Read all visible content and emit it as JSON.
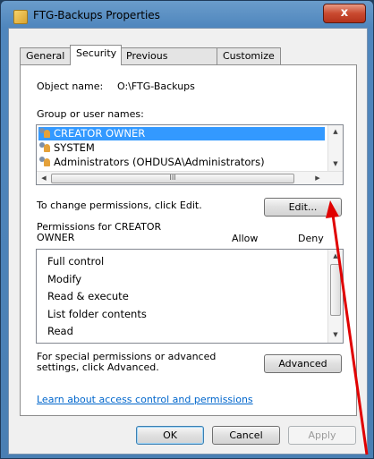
{
  "window": {
    "title": "FTG-Backups Properties",
    "close_glyph": "x"
  },
  "tabs": [
    {
      "label": "General",
      "active": false
    },
    {
      "label": "Security",
      "active": true
    },
    {
      "label": "Previous Versions",
      "active": false
    },
    {
      "label": "Customize",
      "active": false
    }
  ],
  "security": {
    "object_name_label": "Object name:",
    "object_name_value": "O:\\FTG-Backups",
    "group_label": "Group or user names:",
    "users": [
      {
        "name": "CREATOR OWNER",
        "selected": true
      },
      {
        "name": "SYSTEM",
        "selected": false
      },
      {
        "name": "Administrators (OHDUSA\\Administrators)",
        "selected": false
      }
    ],
    "hscroll_grip": "III",
    "change_text": "To change permissions, click Edit.",
    "edit_label": "Edit...",
    "permissions_for": "Permissions for CREATOR OWNER",
    "allow_header": "Allow",
    "deny_header": "Deny",
    "permissions": [
      "Full control",
      "Modify",
      "Read & execute",
      "List folder contents",
      "Read"
    ],
    "special_text": "For special permissions or advanced settings, click Advanced.",
    "advanced_label": "Advanced",
    "learn_link": "Learn about access control and permissions"
  },
  "footer": {
    "ok_label": "OK",
    "cancel_label": "Cancel",
    "apply_label": "Apply"
  },
  "colors": {
    "selection": "#3399ff",
    "link": "#0066cc",
    "annotation_arrow": "#e00000"
  },
  "scroll_glyphs": {
    "up": "▲",
    "down": "▼",
    "left": "◀",
    "right": "▶"
  }
}
